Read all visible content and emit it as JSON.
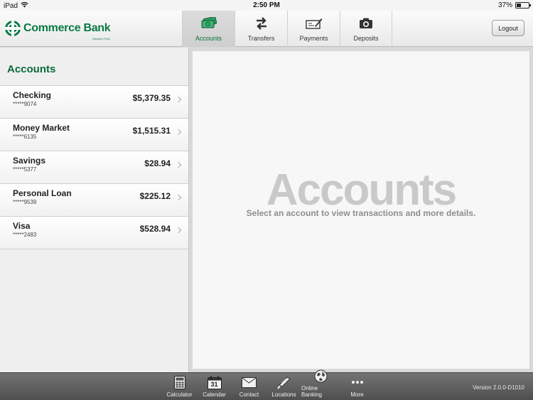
{
  "status_bar": {
    "device": "iPad",
    "time": "2:50 PM",
    "battery": "37%",
    "battery_level": 0.37
  },
  "header": {
    "brand": "Commerce Bank",
    "brand_small": "Member FDIC",
    "tabs": [
      {
        "label": "Accounts",
        "icon": "cash-icon",
        "active": true
      },
      {
        "label": "Transfers",
        "icon": "transfer-arrows-icon",
        "active": false
      },
      {
        "label": "Payments",
        "icon": "check-pen-icon",
        "active": false
      },
      {
        "label": "Deposits",
        "icon": "camera-icon",
        "active": false
      }
    ],
    "logout_label": "Logout"
  },
  "accounts_panel": {
    "title": "Accounts",
    "items": [
      {
        "name": "Checking",
        "number": "*****9074",
        "balance": "$5,379.35"
      },
      {
        "name": "Money Market",
        "number": "*****6135",
        "balance": "$1,515.31"
      },
      {
        "name": "Savings",
        "number": "*****5377",
        "balance": "$28.94"
      },
      {
        "name": "Personal Loan",
        "number": "*****9539",
        "balance": "$225.12"
      },
      {
        "name": "Visa",
        "number": "*****2483",
        "balance": "$528.94"
      }
    ]
  },
  "detail_panel": {
    "title": "Accounts",
    "subtitle": "Select an account to view transactions and more details."
  },
  "footer": {
    "items": [
      {
        "label": "Calculator",
        "icon": "calculator-icon"
      },
      {
        "label": "Calendar",
        "icon": "calendar-icon",
        "icon_text": "31"
      },
      {
        "label": "Contact",
        "icon": "envelope-icon"
      },
      {
        "label": "Locations",
        "icon": "signpost-icon"
      },
      {
        "label": "Online Banking",
        "icon": "globe-icon"
      },
      {
        "label": "More",
        "icon": "more-dots-icon"
      }
    ],
    "version": "Version 2.0.0-D1010"
  },
  "colors": {
    "brand_green": "#0b7a45",
    "active_tab_text": "#0b6a3c"
  }
}
